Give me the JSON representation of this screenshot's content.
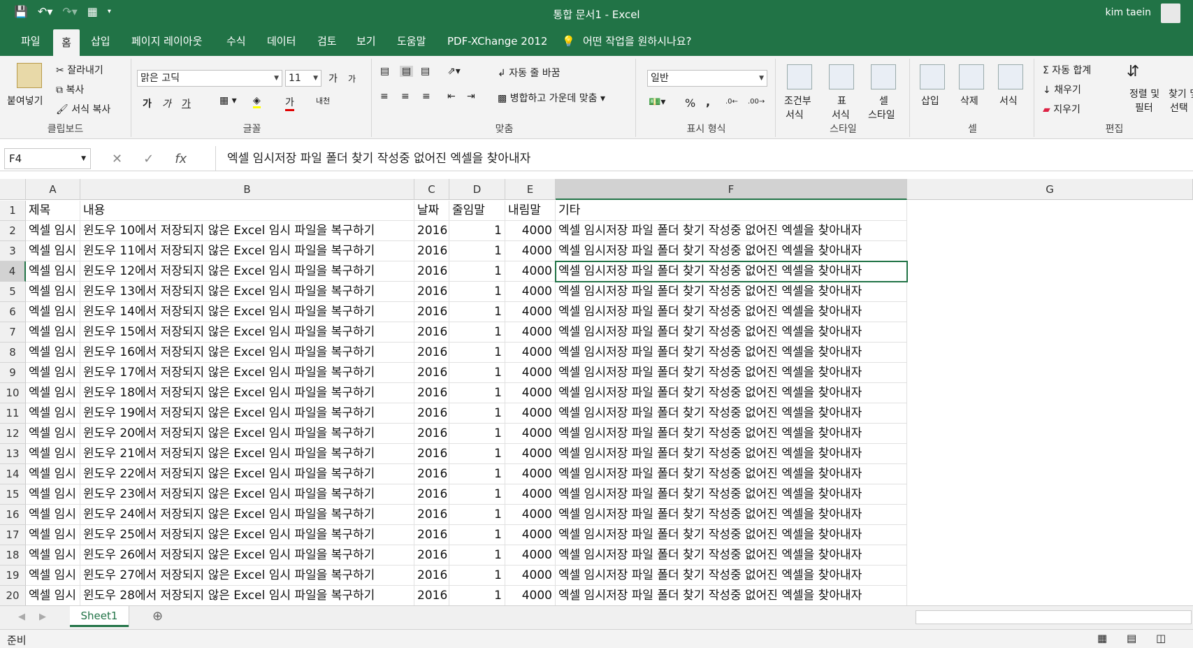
{
  "window": {
    "title": "통합 문서1  -  Excel",
    "user": "kim taein"
  },
  "tabs": [
    "파일",
    "홈",
    "삽입",
    "페이지 레이아웃",
    "수식",
    "데이터",
    "검토",
    "보기",
    "도움말",
    "PDF-XChange 2012",
    "어떤 작업을 원하시나요?"
  ],
  "ribbon": {
    "clipboard": {
      "paste": "붙여넣기",
      "cut": "잘라내기",
      "copy": "복사",
      "format_painter": "서식 복사",
      "label": "클립보드"
    },
    "font": {
      "name": "맑은 고딕",
      "size": "11",
      "grow": "가",
      "shrink": "가",
      "bold": "가",
      "italic": "가",
      "underline": "가",
      "color_a": "가",
      "phonetic": "내천",
      "label": "글꼴"
    },
    "align": {
      "wrap": "자동 줄 바꿈",
      "merge": "병합하고 가운데 맞춤",
      "label": "맞춤"
    },
    "number": {
      "format": "일반",
      "percent": "%",
      "comma": ",",
      "label": "표시 형식"
    },
    "styles": {
      "cond": "조건부",
      "cond2": "서식",
      "table": "표",
      "table2": "서식",
      "cell": "셀",
      "cell2": "스타일",
      "label": "스타일"
    },
    "cells": {
      "insert": "삽입",
      "delete": "삭제",
      "format": "서식",
      "label": "셀"
    },
    "editing": {
      "autosum": "자동 합계",
      "fill": "채우기",
      "clear": "지우기",
      "sort": "정렬 및",
      "sort2": "필터",
      "find": "찾기 및",
      "find2": "선택",
      "label": "편집"
    }
  },
  "formula": {
    "namebox": "F4",
    "content": "엑셀 임시저장 파일 폴더 찾기 작성중 없어진 엑셀을 찾아내자",
    "fx": "fx"
  },
  "columns": [
    "A",
    "B",
    "C",
    "D",
    "E",
    "F",
    "G"
  ],
  "header_row": [
    "제목",
    "내용",
    "날짜",
    "줄임말",
    "내림말",
    "기타"
  ],
  "rows": [
    {
      "n": "2",
      "a": "엑셀 임시",
      "b": "윈도우 10에서 저장되지 않은 Excel 임시 파일을 복구하기",
      "c": "2016",
      "d": "1",
      "e": "4000",
      "f": "엑셀 임시저장 파일 폴더 찾기 작성중 없어진 엑셀을 찾아내자"
    },
    {
      "n": "3",
      "a": "엑셀 임시",
      "b": "윈도우 11에서 저장되지 않은 Excel 임시 파일을 복구하기",
      "c": "2016",
      "d": "1",
      "e": "4000",
      "f": "엑셀 임시저장 파일 폴더 찾기 작성중 없어진 엑셀을 찾아내자"
    },
    {
      "n": "4",
      "a": "엑셀 임시",
      "b": "윈도우 12에서 저장되지 않은 Excel 임시 파일을 복구하기",
      "c": "2016",
      "d": "1",
      "e": "4000",
      "f": "엑셀 임시저장 파일 폴더 찾기 작성중 없어진 엑셀을 찾아내자"
    },
    {
      "n": "5",
      "a": "엑셀 임시",
      "b": "윈도우 13에서 저장되지 않은 Excel 임시 파일을 복구하기",
      "c": "2016",
      "d": "1",
      "e": "4000",
      "f": "엑셀 임시저장 파일 폴더 찾기 작성중 없어진 엑셀을 찾아내자"
    },
    {
      "n": "6",
      "a": "엑셀 임시",
      "b": "윈도우 14에서 저장되지 않은 Excel 임시 파일을 복구하기",
      "c": "2016",
      "d": "1",
      "e": "4000",
      "f": "엑셀 임시저장 파일 폴더 찾기 작성중 없어진 엑셀을 찾아내자"
    },
    {
      "n": "7",
      "a": "엑셀 임시",
      "b": "윈도우 15에서 저장되지 않은 Excel 임시 파일을 복구하기",
      "c": "2016",
      "d": "1",
      "e": "4000",
      "f": "엑셀 임시저장 파일 폴더 찾기 작성중 없어진 엑셀을 찾아내자"
    },
    {
      "n": "8",
      "a": "엑셀 임시",
      "b": "윈도우 16에서 저장되지 않은 Excel 임시 파일을 복구하기",
      "c": "2016",
      "d": "1",
      "e": "4000",
      "f": "엑셀 임시저장 파일 폴더 찾기 작성중 없어진 엑셀을 찾아내자"
    },
    {
      "n": "9",
      "a": "엑셀 임시",
      "b": "윈도우 17에서 저장되지 않은 Excel 임시 파일을 복구하기",
      "c": "2016",
      "d": "1",
      "e": "4000",
      "f": "엑셀 임시저장 파일 폴더 찾기 작성중 없어진 엑셀을 찾아내자"
    },
    {
      "n": "10",
      "a": "엑셀 임시",
      "b": "윈도우 18에서 저장되지 않은 Excel 임시 파일을 복구하기",
      "c": "2016",
      "d": "1",
      "e": "4000",
      "f": "엑셀 임시저장 파일 폴더 찾기 작성중 없어진 엑셀을 찾아내자"
    },
    {
      "n": "11",
      "a": "엑셀 임시",
      "b": "윈도우 19에서 저장되지 않은 Excel 임시 파일을 복구하기",
      "c": "2016",
      "d": "1",
      "e": "4000",
      "f": "엑셀 임시저장 파일 폴더 찾기 작성중 없어진 엑셀을 찾아내자"
    },
    {
      "n": "12",
      "a": "엑셀 임시",
      "b": "윈도우 20에서 저장되지 않은 Excel 임시 파일을 복구하기",
      "c": "2016",
      "d": "1",
      "e": "4000",
      "f": "엑셀 임시저장 파일 폴더 찾기 작성중 없어진 엑셀을 찾아내자"
    },
    {
      "n": "13",
      "a": "엑셀 임시",
      "b": "윈도우 21에서 저장되지 않은 Excel 임시 파일을 복구하기",
      "c": "2016",
      "d": "1",
      "e": "4000",
      "f": "엑셀 임시저장 파일 폴더 찾기 작성중 없어진 엑셀을 찾아내자"
    },
    {
      "n": "14",
      "a": "엑셀 임시",
      "b": "윈도우 22에서 저장되지 않은 Excel 임시 파일을 복구하기",
      "c": "2016",
      "d": "1",
      "e": "4000",
      "f": "엑셀 임시저장 파일 폴더 찾기 작성중 없어진 엑셀을 찾아내자"
    },
    {
      "n": "15",
      "a": "엑셀 임시",
      "b": "윈도우 23에서 저장되지 않은 Excel 임시 파일을 복구하기",
      "c": "2016",
      "d": "1",
      "e": "4000",
      "f": "엑셀 임시저장 파일 폴더 찾기 작성중 없어진 엑셀을 찾아내자"
    },
    {
      "n": "16",
      "a": "엑셀 임시",
      "b": "윈도우 24에서 저장되지 않은 Excel 임시 파일을 복구하기",
      "c": "2016",
      "d": "1",
      "e": "4000",
      "f": "엑셀 임시저장 파일 폴더 찾기 작성중 없어진 엑셀을 찾아내자"
    },
    {
      "n": "17",
      "a": "엑셀 임시",
      "b": "윈도우 25에서 저장되지 않은 Excel 임시 파일을 복구하기",
      "c": "2016",
      "d": "1",
      "e": "4000",
      "f": "엑셀 임시저장 파일 폴더 찾기 작성중 없어진 엑셀을 찾아내자"
    },
    {
      "n": "18",
      "a": "엑셀 임시",
      "b": "윈도우 26에서 저장되지 않은 Excel 임시 파일을 복구하기",
      "c": "2016",
      "d": "1",
      "e": "4000",
      "f": "엑셀 임시저장 파일 폴더 찾기 작성중 없어진 엑셀을 찾아내자"
    },
    {
      "n": "19",
      "a": "엑셀 임시",
      "b": "윈도우 27에서 저장되지 않은 Excel 임시 파일을 복구하기",
      "c": "2016",
      "d": "1",
      "e": "4000",
      "f": "엑셀 임시저장 파일 폴더 찾기 작성중 없어진 엑셀을 찾아내자"
    },
    {
      "n": "20",
      "a": "엑셀 임시",
      "b": "윈도우 28에서 저장되지 않은 Excel 임시 파일을 복구하기",
      "c": "2016",
      "d": "1",
      "e": "4000",
      "f": "엑셀 임시저장 파일 폴더 찾기 작성중 없어진 엑셀을 찾아내자"
    }
  ],
  "sheet_tab": "Sheet1",
  "status": "준비",
  "colors": {
    "accent": "#217346"
  }
}
